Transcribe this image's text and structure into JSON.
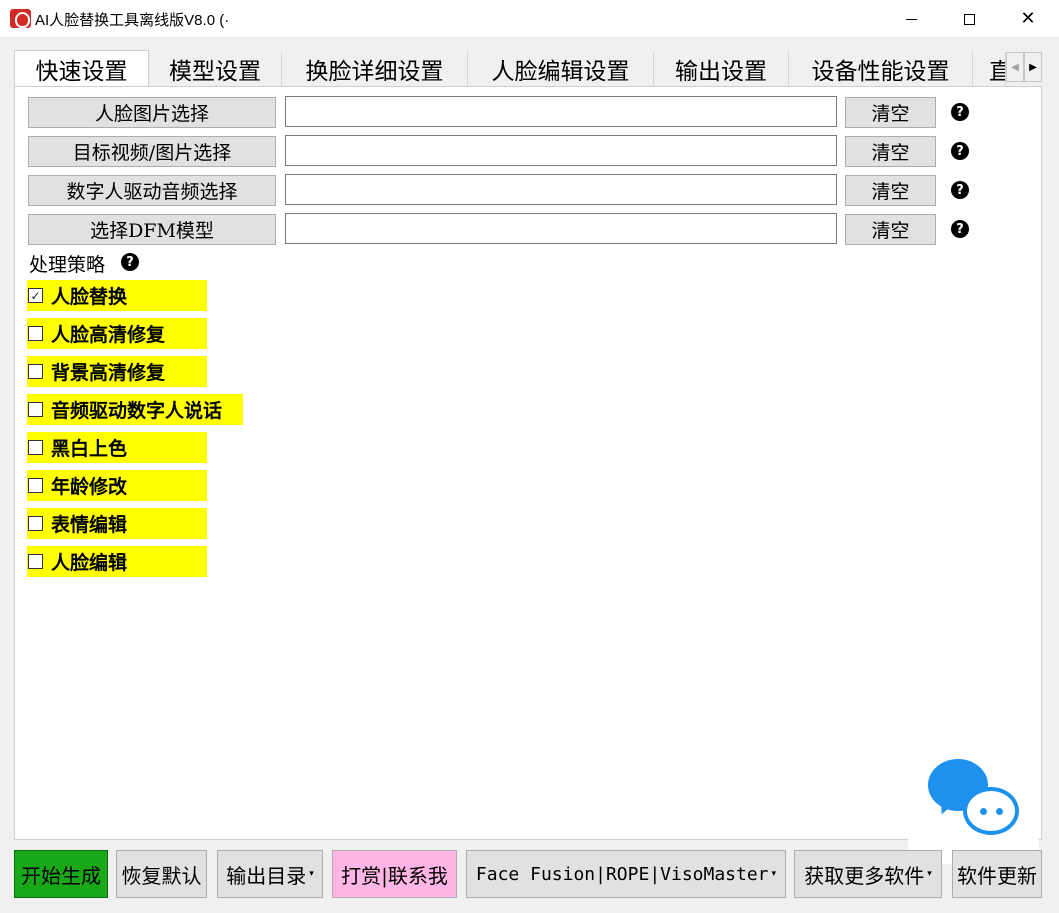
{
  "window": {
    "title": "AI人脸替换工具离线版V8.0 (·",
    "minimize": "minimize",
    "maximize": "maximize",
    "close": "close"
  },
  "tabs": [
    {
      "label": "快速设置",
      "active": true
    },
    {
      "label": "模型设置",
      "active": false
    },
    {
      "label": "换脸详细设置",
      "active": false
    },
    {
      "label": "人脸编辑设置",
      "active": false
    },
    {
      "label": "输出设置",
      "active": false
    },
    {
      "label": "设备性能设置",
      "active": false
    },
    {
      "label": "直",
      "active": false
    }
  ],
  "tab_scroll": {
    "left": "◀",
    "right": "▶"
  },
  "file_rows": [
    {
      "button": "人脸图片选择",
      "value": "",
      "clear": "清空"
    },
    {
      "button": "目标视频/图片选择",
      "value": "",
      "clear": "清空"
    },
    {
      "button": "数字人驱动音频选择",
      "value": "",
      "clear": "清空"
    },
    {
      "button": "选择DFM模型",
      "value": "",
      "clear": "清空"
    }
  ],
  "help_glyph": "?",
  "strategy": {
    "label": "处理策略",
    "options": [
      {
        "label": "人脸替换",
        "checked": true
      },
      {
        "label": "人脸高清修复",
        "checked": false
      },
      {
        "label": "背景高清修复",
        "checked": false
      },
      {
        "label": "音频驱动数字人说话",
        "checked": false
      },
      {
        "label": "黑白上色",
        "checked": false
      },
      {
        "label": "年龄修改",
        "checked": false
      },
      {
        "label": "表情编辑",
        "checked": false
      },
      {
        "label": "人脸编辑",
        "checked": false
      }
    ],
    "check_mark": "✓"
  },
  "bottom_buttons": {
    "start": "开始生成",
    "reset": "恢复默认",
    "output_dir": "输出目录",
    "donate": "打赏|联系我",
    "face_fusion": "Face Fusion|ROPE|VisoMaster",
    "more_software": "获取更多软件",
    "update": "软件更新",
    "caret": "▾"
  },
  "colors": {
    "start_bg": "#18a818",
    "donate_bg": "#ffb6e4",
    "option_bg": "#ffff00",
    "chat_icon": "#1e91ee"
  },
  "icons": {
    "app": "app-logo-icon",
    "help": "question-circle-icon",
    "chat": "wechat-chat-icon"
  }
}
